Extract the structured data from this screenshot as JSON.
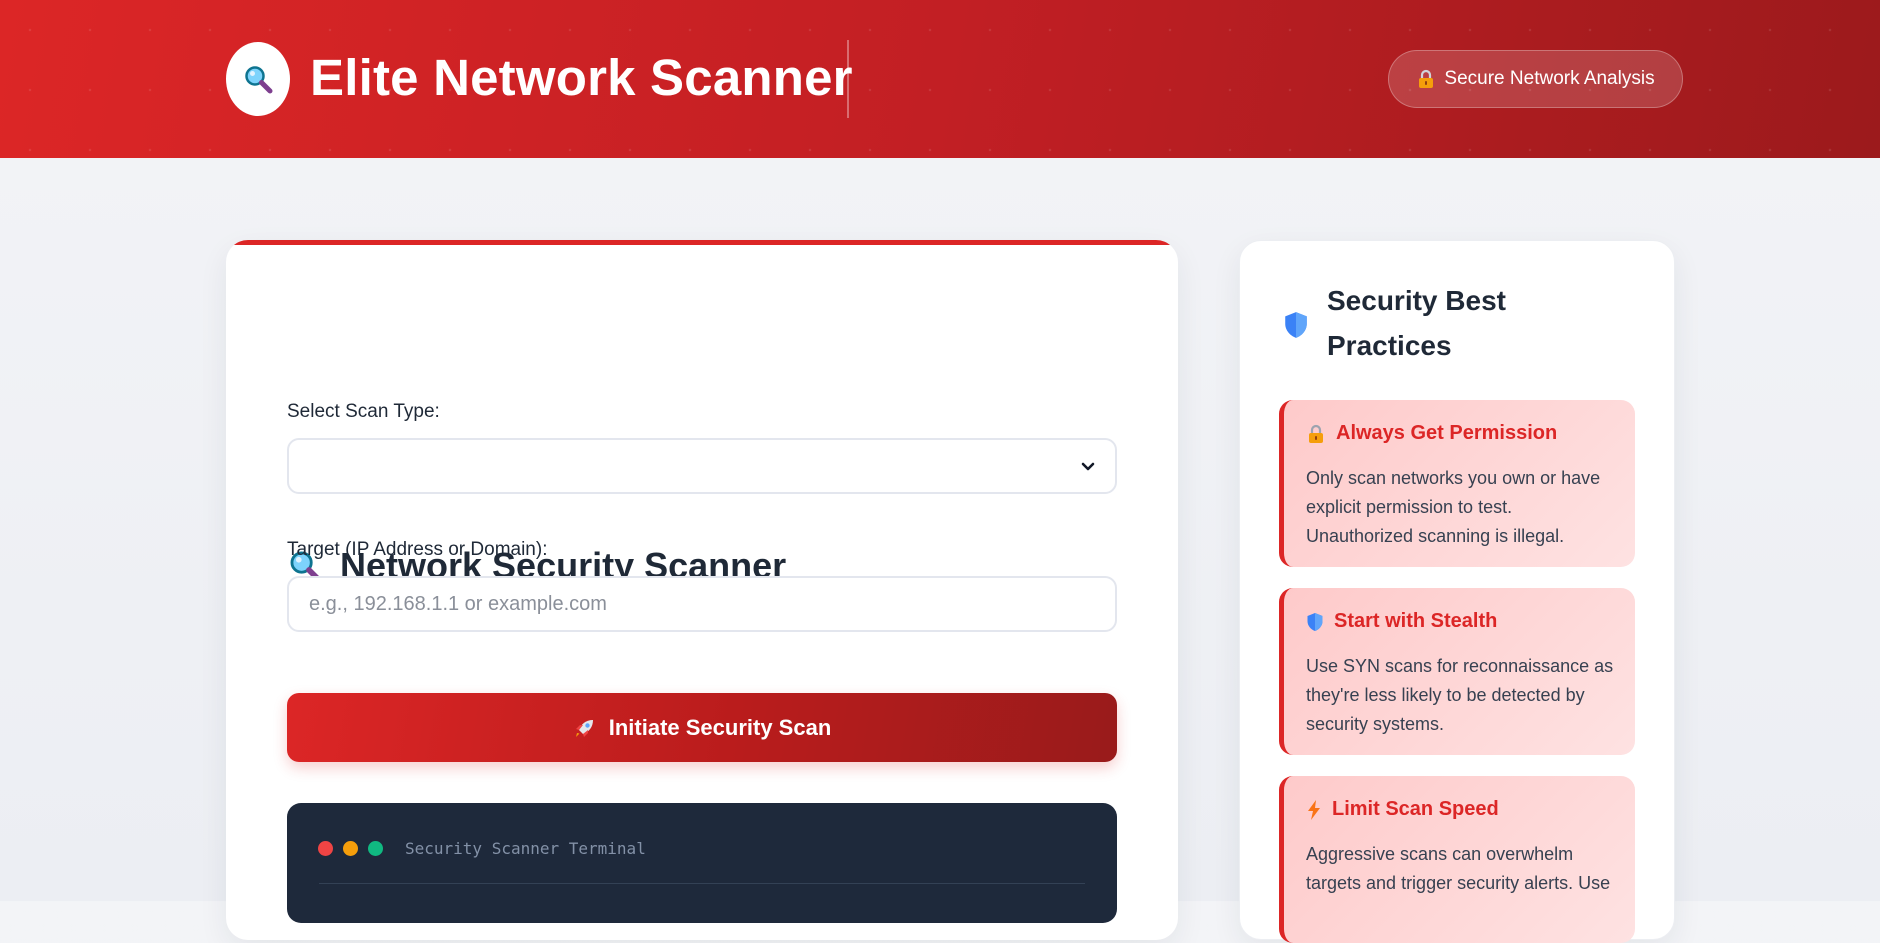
{
  "header": {
    "title": "Elite Network Scanner",
    "logo_icon": "magnifier-icon",
    "badge_label": "Secure Network Analysis",
    "badge_icon": "lock-icon"
  },
  "scanner": {
    "title": "Network Security Scanner",
    "title_icon": "magnifier-icon",
    "scan_type_label": "Select Scan Type:",
    "scan_type_value": "",
    "target_label": "Target (IP Address or Domain):",
    "target_value": "",
    "target_placeholder": "e.g., 192.168.1.1 or example.com",
    "scan_button_label": "Initiate Security Scan",
    "scan_button_icon": "rocket-icon",
    "terminal_title": "Security Scanner Terminal"
  },
  "sidebar": {
    "title": "Security Best Practices",
    "title_icon": "shield-icon",
    "tips": [
      {
        "icon": "lock-icon",
        "title": "Always Get Permission",
        "body": "Only scan networks you own or have explicit permission to test. Unauthorized scanning is illegal."
      },
      {
        "icon": "shield-icon",
        "title": "Start with Stealth",
        "body": "Use SYN scans for reconnaissance as they're less likely to be detected by security systems."
      },
      {
        "icon": "lightning-icon",
        "title": "Limit Scan Speed",
        "body": "Aggressive scans can overwhelm targets and trigger security alerts. Use"
      }
    ]
  },
  "colors": {
    "brand_red": "#dc2626",
    "brand_dark_red": "#991b1b",
    "terminal_bg": "#1e293b",
    "dot_red": "#ef4444",
    "dot_yellow": "#f59e0b",
    "dot_green": "#10b981"
  }
}
